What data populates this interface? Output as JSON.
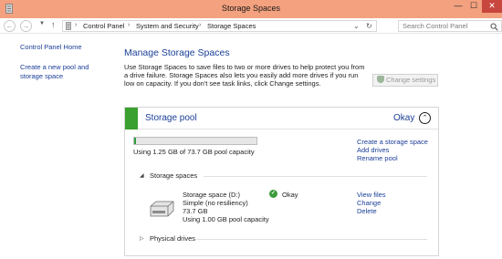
{
  "window": {
    "title": "Storage Spaces",
    "minimize_glyph": "—",
    "maximize_glyph": "☐",
    "close_glyph": "✕"
  },
  "nav": {
    "back_glyph": "←",
    "forward_glyph": "→",
    "dropdown_glyph": "▼",
    "up_glyph": "↑"
  },
  "address": {
    "breadcrumbs": [
      "Control Panel",
      "System and Security",
      "Storage Spaces"
    ],
    "separator": "›",
    "dropdown_glyph": "⌄",
    "refresh_glyph": "↻"
  },
  "search": {
    "placeholder": "Search Control Panel",
    "icon": "search-icon"
  },
  "left_pane": {
    "home_link": "Control Panel Home",
    "create_link": "Create a new pool and storage space"
  },
  "main": {
    "title": "Manage Storage Spaces",
    "intro": "Use Storage Spaces to save files to two or more drives to help protect you from a drive failure. Storage Spaces also lets you easily add more drives if you run low on capacity. If you don't see task links, click Change settings.",
    "change_settings": "Change settings"
  },
  "pool": {
    "name": "Storage pool",
    "status": "Okay",
    "accent_color": "#3aa02f",
    "collapse_glyph": "⌃",
    "capacity_fraction": 0.017,
    "capacity_text": "Using 1.25 GB of 73.7 GB pool capacity",
    "links": [
      "Create a storage space",
      "Add drives",
      "Rename pool"
    ],
    "storage_spaces_label": "Storage spaces",
    "expanded_glyph": "◢",
    "collapsed_glyph": "▷",
    "space": {
      "name": "Storage space (D:)",
      "resiliency": "Simple (no resiliency)",
      "size": "73.7 GB",
      "usage": "Using 1.00 GB pool capacity",
      "status": "Okay",
      "status_glyph": "✓",
      "links": [
        "View files",
        "Change",
        "Delete"
      ]
    },
    "physical_drives_label": "Physical drives"
  }
}
